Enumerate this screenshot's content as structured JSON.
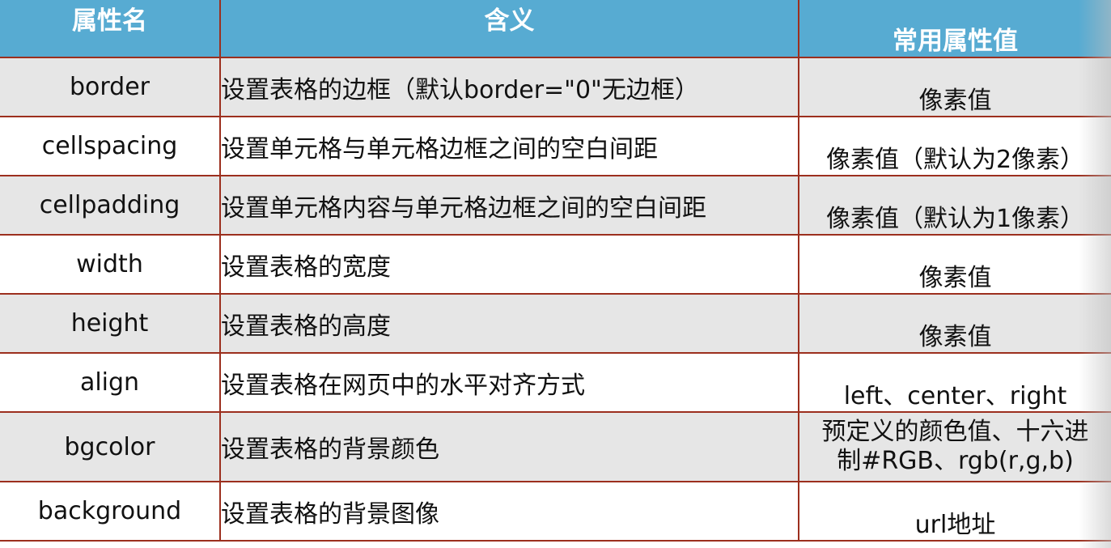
{
  "table": {
    "headers": {
      "name": "属性名",
      "meaning": "含义",
      "values": "常用属性值"
    },
    "rows": [
      {
        "name": "border",
        "meaning": "设置表格的边框（默认border=\"0\"无边框）",
        "values": "像素值"
      },
      {
        "name": "cellspacing",
        "meaning": "设置单元格与单元格边框之间的空白间距",
        "values": "像素值（默认为2像素）"
      },
      {
        "name": "cellpadding",
        "meaning": "设置单元格内容与单元格边框之间的空白间距",
        "values": "像素值（默认为1像素）"
      },
      {
        "name": "width",
        "meaning": "设置表格的宽度",
        "values": "像素值"
      },
      {
        "name": "height",
        "meaning": "设置表格的高度",
        "values": "像素值"
      },
      {
        "name": "align",
        "meaning": "设置表格在网页中的水平对齐方式",
        "values": "left、center、right"
      },
      {
        "name": "bgcolor",
        "meaning": "设置表格的背景颜色",
        "values": "预定义的颜色值、十六进制#RGB、rgb(r,g,b)"
      },
      {
        "name": "background",
        "meaning": "设置表格的背景图像",
        "values": "url地址"
      }
    ]
  },
  "colors": {
    "header_bg": "#57abd2",
    "border": "#9c2f1e",
    "alt_row_bg": "#e6e6e6"
  }
}
